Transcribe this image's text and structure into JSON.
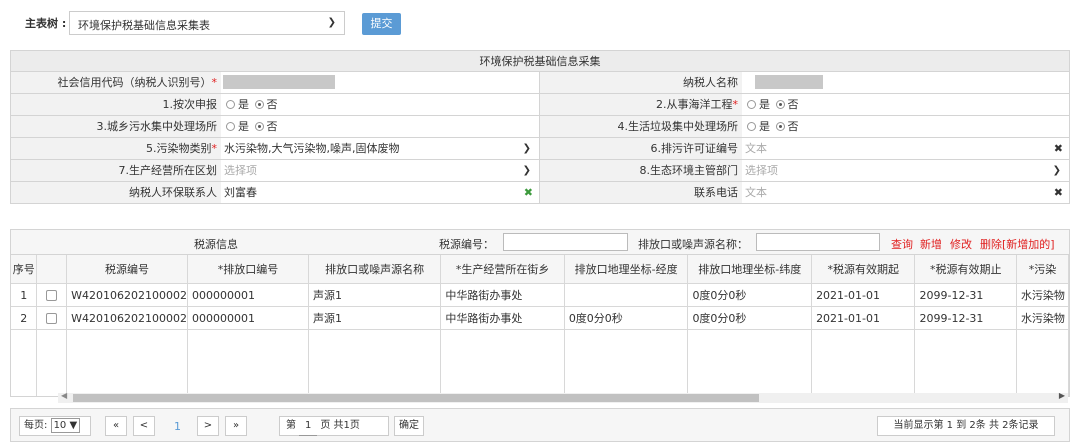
{
  "header": {
    "main_table_label": "主表树 :",
    "main_table_value": "环境保护税基础信息采集表",
    "submit_label": "提交"
  },
  "form": {
    "title": "环境保护税基础信息采集",
    "credit_code_label": "社会信用代码（纳税人识别号）",
    "taxpayer_name_label": "纳税人名称",
    "declare_label": "1.按次申报",
    "marine_label": "2.从事海洋工程",
    "sewage_label": "3.城乡污水集中处理场所",
    "garbage_label": "4.生活垃圾集中处理场所",
    "pollutant_label": "5.污染物类别",
    "pollutant_value": "水污染物,大气污染物,噪声,固体废物",
    "permit_label": "6.排污许可证编号",
    "permit_placeholder": "文本",
    "district_label": "7.生产经营所在区划",
    "district_placeholder": "选择项",
    "eco_label": "8.生态环境主管部门",
    "eco_placeholder": "选择项",
    "contact_label": "纳税人环保联系人",
    "contact_value": "刘富春",
    "phone_label": "联系电话",
    "phone_placeholder": "文本",
    "yes": "是",
    "no": "否",
    "req": "*"
  },
  "grid": {
    "title": "税源信息",
    "source_no_label": "税源编号：",
    "outlet_label": "排放口或噪声源名称：",
    "actions": [
      "查询",
      "新增",
      "修改",
      "删除[新增加的]"
    ],
    "columns": [
      "序号",
      "",
      "税源编号",
      "*排放口编号",
      "排放口或噪声源名称",
      "*生产经营所在街乡",
      "排放口地理坐标-经度",
      "排放口地理坐标-纬度",
      "*税源有效期起",
      "*税源有效期止",
      "*污染"
    ],
    "rows": [
      [
        "1",
        "",
        "W420106202100002",
        "000000001",
        "声源1",
        "中华路街办事处",
        "",
        "0度0分0秒",
        "2021-01-01",
        "2099-12-31",
        "水污染物"
      ],
      [
        "2",
        "",
        "W420106202100002",
        "000000001",
        "声源1",
        "中华路街办事处",
        "0度0分0秒",
        "0度0分0秒",
        "2021-01-01",
        "2099-12-31",
        "水污染物"
      ]
    ]
  },
  "pager": {
    "per_page_label": "每页:",
    "per_page_value": "10",
    "first": "«",
    "prev": "<",
    "current": "1",
    "next": ">",
    "last": "»",
    "page_prefix": "第",
    "page_value": "1",
    "page_suffix": "页 共1页",
    "confirm": "确定",
    "summary": "当前显示第  1 到  2条 共  2条记录"
  }
}
